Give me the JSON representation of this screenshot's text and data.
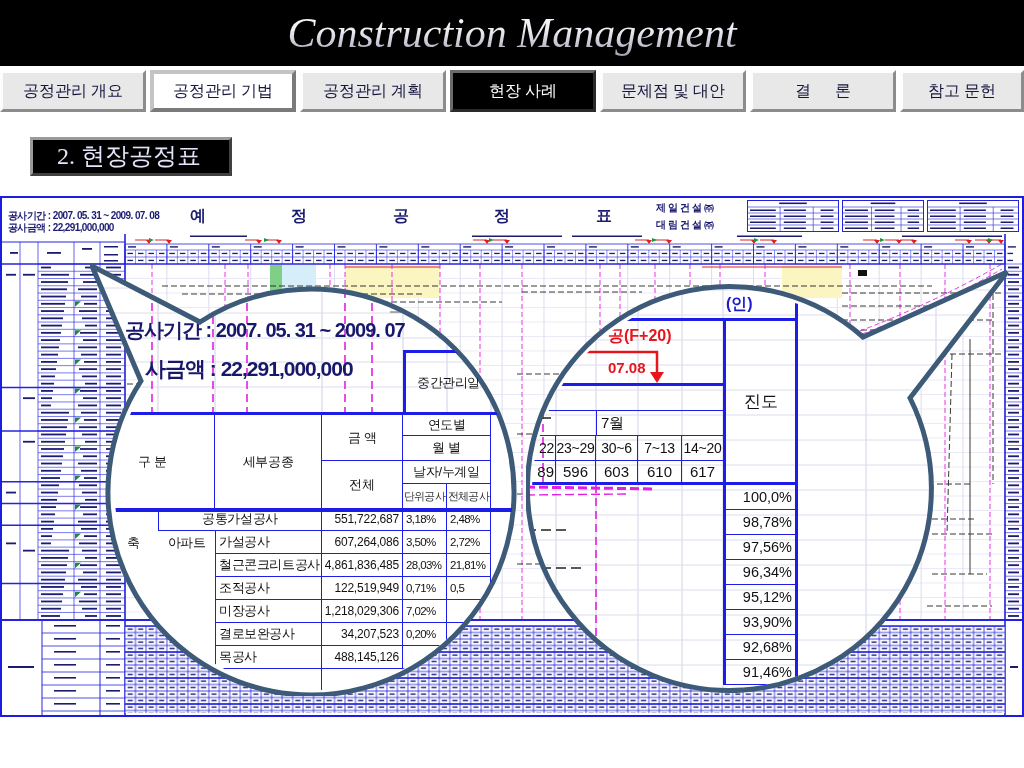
{
  "header": {
    "title": "Construction Management"
  },
  "tabs": [
    {
      "label": "공정관리 개요",
      "selected": false,
      "framed": false
    },
    {
      "label": "공정관리 기법",
      "selected": false,
      "framed": true
    },
    {
      "label": "공정관리 계획",
      "selected": false,
      "framed": false
    },
    {
      "label": "현장 사례",
      "selected": true,
      "framed": false
    },
    {
      "label": "문제점 및 대안",
      "selected": false,
      "framed": false
    },
    {
      "label": "결      론",
      "selected": false,
      "framed": false
    },
    {
      "label": "참고 문헌",
      "selected": false,
      "framed": false
    }
  ],
  "section_label": "2. 현장공정표",
  "schedule_sheet": {
    "period": "공사기간 : 2007. 05. 31 ~ 2009. 07. 08",
    "amount": "공사금액 : 22,291,000,000",
    "title": "예 정 공 정 표",
    "companies": [
      "제일건설㈜",
      "대림건설㈜"
    ]
  },
  "left_magnifier": {
    "period": "공사기간 : 2007. 05. 31 ~ 2009. 07",
    "amount": "사금액 : 22,291,000,000",
    "interim_date_header": "중간관리일",
    "headers": {
      "category": "구 분",
      "work_type": "세부공종",
      "amount": "금 액",
      "amount_total": "전체",
      "by_year": "연도별",
      "by_month": "월 별",
      "date_cumulative": "날자/누계일",
      "unit_work": "단위공사",
      "all_work": "전체공사"
    },
    "category": "축",
    "subcategory": "아파트",
    "rows": [
      {
        "kind": "common",
        "work": "공통가설공사",
        "amount": "551,722,687",
        "unit_share": "3,18%",
        "total_share": "2,48%"
      },
      {
        "kind": "item",
        "work": "가설공사",
        "amount": "607,264,086",
        "unit_share": "3,50%",
        "total_share": "2,72%"
      },
      {
        "kind": "item",
        "work": "철근콘크리트공사",
        "amount": "4,861,836,485",
        "unit_share": "28,03%",
        "total_share": "21,81%"
      },
      {
        "kind": "item",
        "work": "조적공사",
        "amount": "122,519,949",
        "unit_share": "0,71%",
        "total_share": "0,5"
      },
      {
        "kind": "item",
        "work": "미장공사",
        "amount": "1,218,029,306",
        "unit_share": "7,02%"
      },
      {
        "kind": "item",
        "work": "결로보완공사",
        "amount": "34,207,523",
        "unit_share": "0,20%"
      },
      {
        "kind": "item",
        "work": "목공사",
        "amount": "488,145,126"
      }
    ]
  },
  "right_magnifier": {
    "seal": "(인)",
    "milestone": {
      "label": "공(F+20)",
      "date": "07.08"
    },
    "progress_header": "진도",
    "month": "7월",
    "weeks": [
      "22",
      "23~29",
      "30~6",
      "7~13",
      "14~20"
    ],
    "days": [
      "89",
      "596",
      "603",
      "610",
      "617"
    ],
    "progress": [
      "100,0%",
      "98,78%",
      "97,56%",
      "96,34%",
      "95,12%",
      "93,90%",
      "92,68%",
      "91,46%"
    ]
  }
}
